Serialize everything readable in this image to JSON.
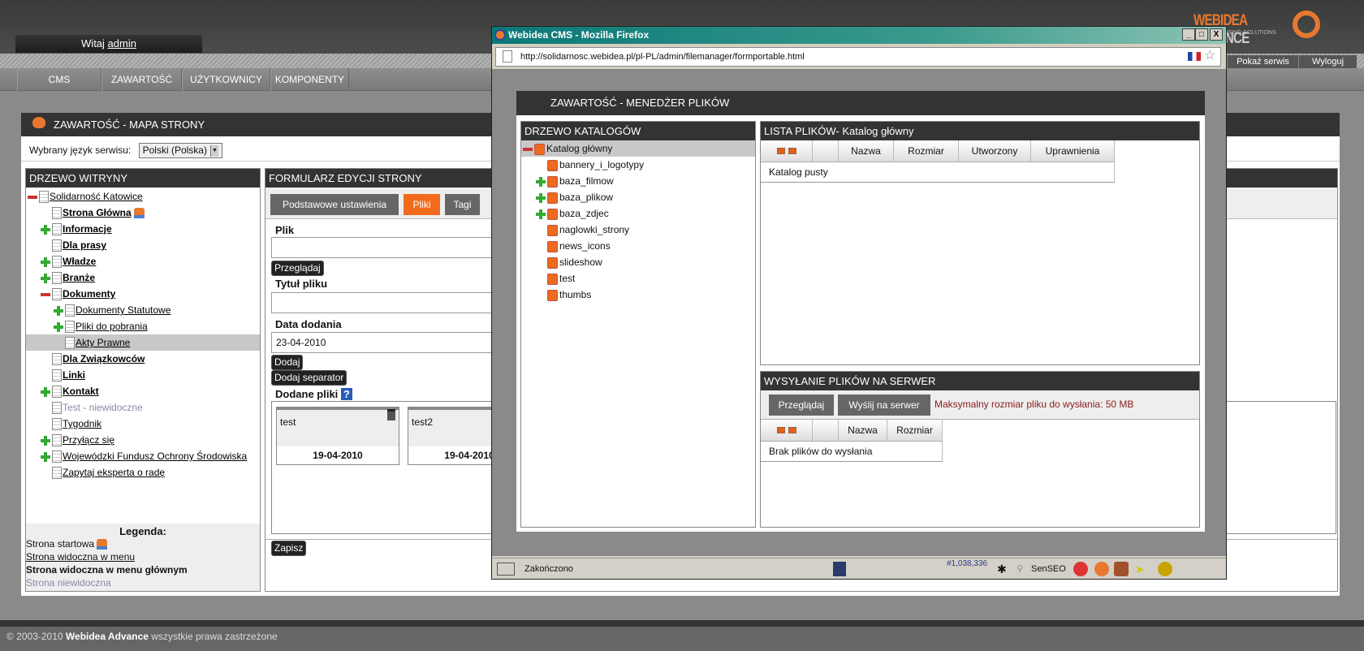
{
  "header": {
    "welcome_prefix": "Witaj",
    "username": "admin",
    "logo_text": "WEBIDEA ADVANCE",
    "logo_sub": "ADVERTISING SOLUTIONS",
    "show_site": "Pokaż serwis",
    "logout": "Wyloguj"
  },
  "menu": [
    "CMS",
    "ZAWARTOŚĆ",
    "UŻYTKOWNICY",
    "KOMPONENTY"
  ],
  "main": {
    "title": "ZAWARTOŚĆ - MAPA STRONY",
    "lang_label": "Wybrany język serwisu:",
    "lang_value": "Polski (Polska)"
  },
  "tree": {
    "title": "DRZEWO WITRYNY",
    "items": [
      {
        "label": "Solidarność Katowice",
        "level": 0,
        "exp": "minus",
        "style": "normal"
      },
      {
        "label": "Strona Główna",
        "level": 1,
        "exp": "none",
        "style": "bold",
        "home": true
      },
      {
        "label": "Informacje",
        "level": 1,
        "exp": "plus",
        "style": "bold"
      },
      {
        "label": "Dla prasy",
        "level": 1,
        "exp": "none",
        "style": "bold"
      },
      {
        "label": "Władze",
        "level": 1,
        "exp": "plus",
        "style": "bold"
      },
      {
        "label": "Branże",
        "level": 1,
        "exp": "plus",
        "style": "bold"
      },
      {
        "label": "Dokumenty",
        "level": 1,
        "exp": "minus",
        "style": "bold"
      },
      {
        "label": "Dokumenty Statutowe",
        "level": 2,
        "exp": "plus",
        "style": "normal"
      },
      {
        "label": "Pliki do pobrania",
        "level": 2,
        "exp": "plus",
        "style": "normal"
      },
      {
        "label": "Akty Prawne",
        "level": 2,
        "exp": "none",
        "style": "normal",
        "selected": true
      },
      {
        "label": "Dla Związkowców",
        "level": 1,
        "exp": "none",
        "style": "bold"
      },
      {
        "label": "Linki",
        "level": 1,
        "exp": "none",
        "style": "bold"
      },
      {
        "label": "Kontakt",
        "level": 1,
        "exp": "plus",
        "style": "bold"
      },
      {
        "label": "Test - niewidoczne",
        "level": 1,
        "exp": "none",
        "style": "hidden"
      },
      {
        "label": "Tygodnik",
        "level": 1,
        "exp": "none",
        "style": "normal"
      },
      {
        "label": "Przyłącz się",
        "level": 1,
        "exp": "plus",
        "style": "normal"
      },
      {
        "label": "Wojewódzki Fundusz Ochrony Środowiska",
        "level": 1,
        "exp": "plus",
        "style": "normal"
      },
      {
        "label": "Zapytaj eksperta o radę",
        "level": 1,
        "exp": "none",
        "style": "normal"
      }
    ]
  },
  "legend": {
    "title": "Legenda:",
    "start": "Strona startowa",
    "menu": "Strona widoczna w menu",
    "main_menu": "Strona widoczna w menu głównym",
    "hidden": "Strona niewidoczna"
  },
  "form": {
    "title": "FORMULARZ EDYCJI STRONY",
    "tabs": [
      "Podstawowe ustawienia",
      "Pliki",
      "Tagi"
    ],
    "file_label": "Plik",
    "browse": "Przeglądaj",
    "file_title_label": "Tytuł pliku",
    "date_label": "Data dodania",
    "date_value": "23-04-2010",
    "add": "Dodaj",
    "add_separator": "Dodaj separator",
    "added_label": "Dodane pliki",
    "help": "?",
    "files": [
      {
        "name": "test",
        "date": "19-04-2010"
      },
      {
        "name": "test2",
        "date": "19-04-2010"
      }
    ],
    "save": "Zapisz"
  },
  "footer": {
    "copy": "© 2003-2010",
    "brand": "Webidea Advance",
    "rights": "wszystkie prawa zastrzeżone"
  },
  "popup": {
    "window_title": "Webidea CMS - Mozilla Firefox",
    "url": "http://solidarnosc.webidea.pl/pl-PL/admin/filemanager/formportable.html",
    "title": "ZAWARTOŚĆ - MENEDŻER PLIKÓW",
    "dir_tree": {
      "title": "DRZEWO KATALOGÓW",
      "root": "Katalog główny",
      "folders": [
        {
          "name": "bannery_i_logotypy",
          "exp": false
        },
        {
          "name": "baza_filmow",
          "exp": true
        },
        {
          "name": "baza_plikow",
          "exp": true
        },
        {
          "name": "baza_zdjec",
          "exp": true
        },
        {
          "name": "naglowki_strony",
          "exp": false
        },
        {
          "name": "news_icons",
          "exp": false
        },
        {
          "name": "slideshow",
          "exp": false
        },
        {
          "name": "test",
          "exp": false
        },
        {
          "name": "thumbs",
          "exp": false
        }
      ]
    },
    "file_list": {
      "title": "LISTA PLIKÓW- Katalog główny",
      "columns": [
        "Nazwa",
        "Rozmiar",
        "Utworzony",
        "Uprawnienia"
      ],
      "empty": "Katalog pusty"
    },
    "upload": {
      "title": "WYSYŁANIE PLIKÓW NA SERWER",
      "browse": "Przeglądaj",
      "send": "Wyślij na serwer",
      "max_size": "Maksymalny rozmiar pliku do wysłania: 50 MB",
      "columns": [
        "Nazwa",
        "Rozmiar"
      ],
      "empty": "Brak plików do wysłania"
    },
    "status": {
      "text": "Zakończono",
      "rank": "#1,038,336",
      "senseo": "SenSEO"
    },
    "accent": "#f26b1d",
    "max_size_color": "#8b1a1a"
  }
}
